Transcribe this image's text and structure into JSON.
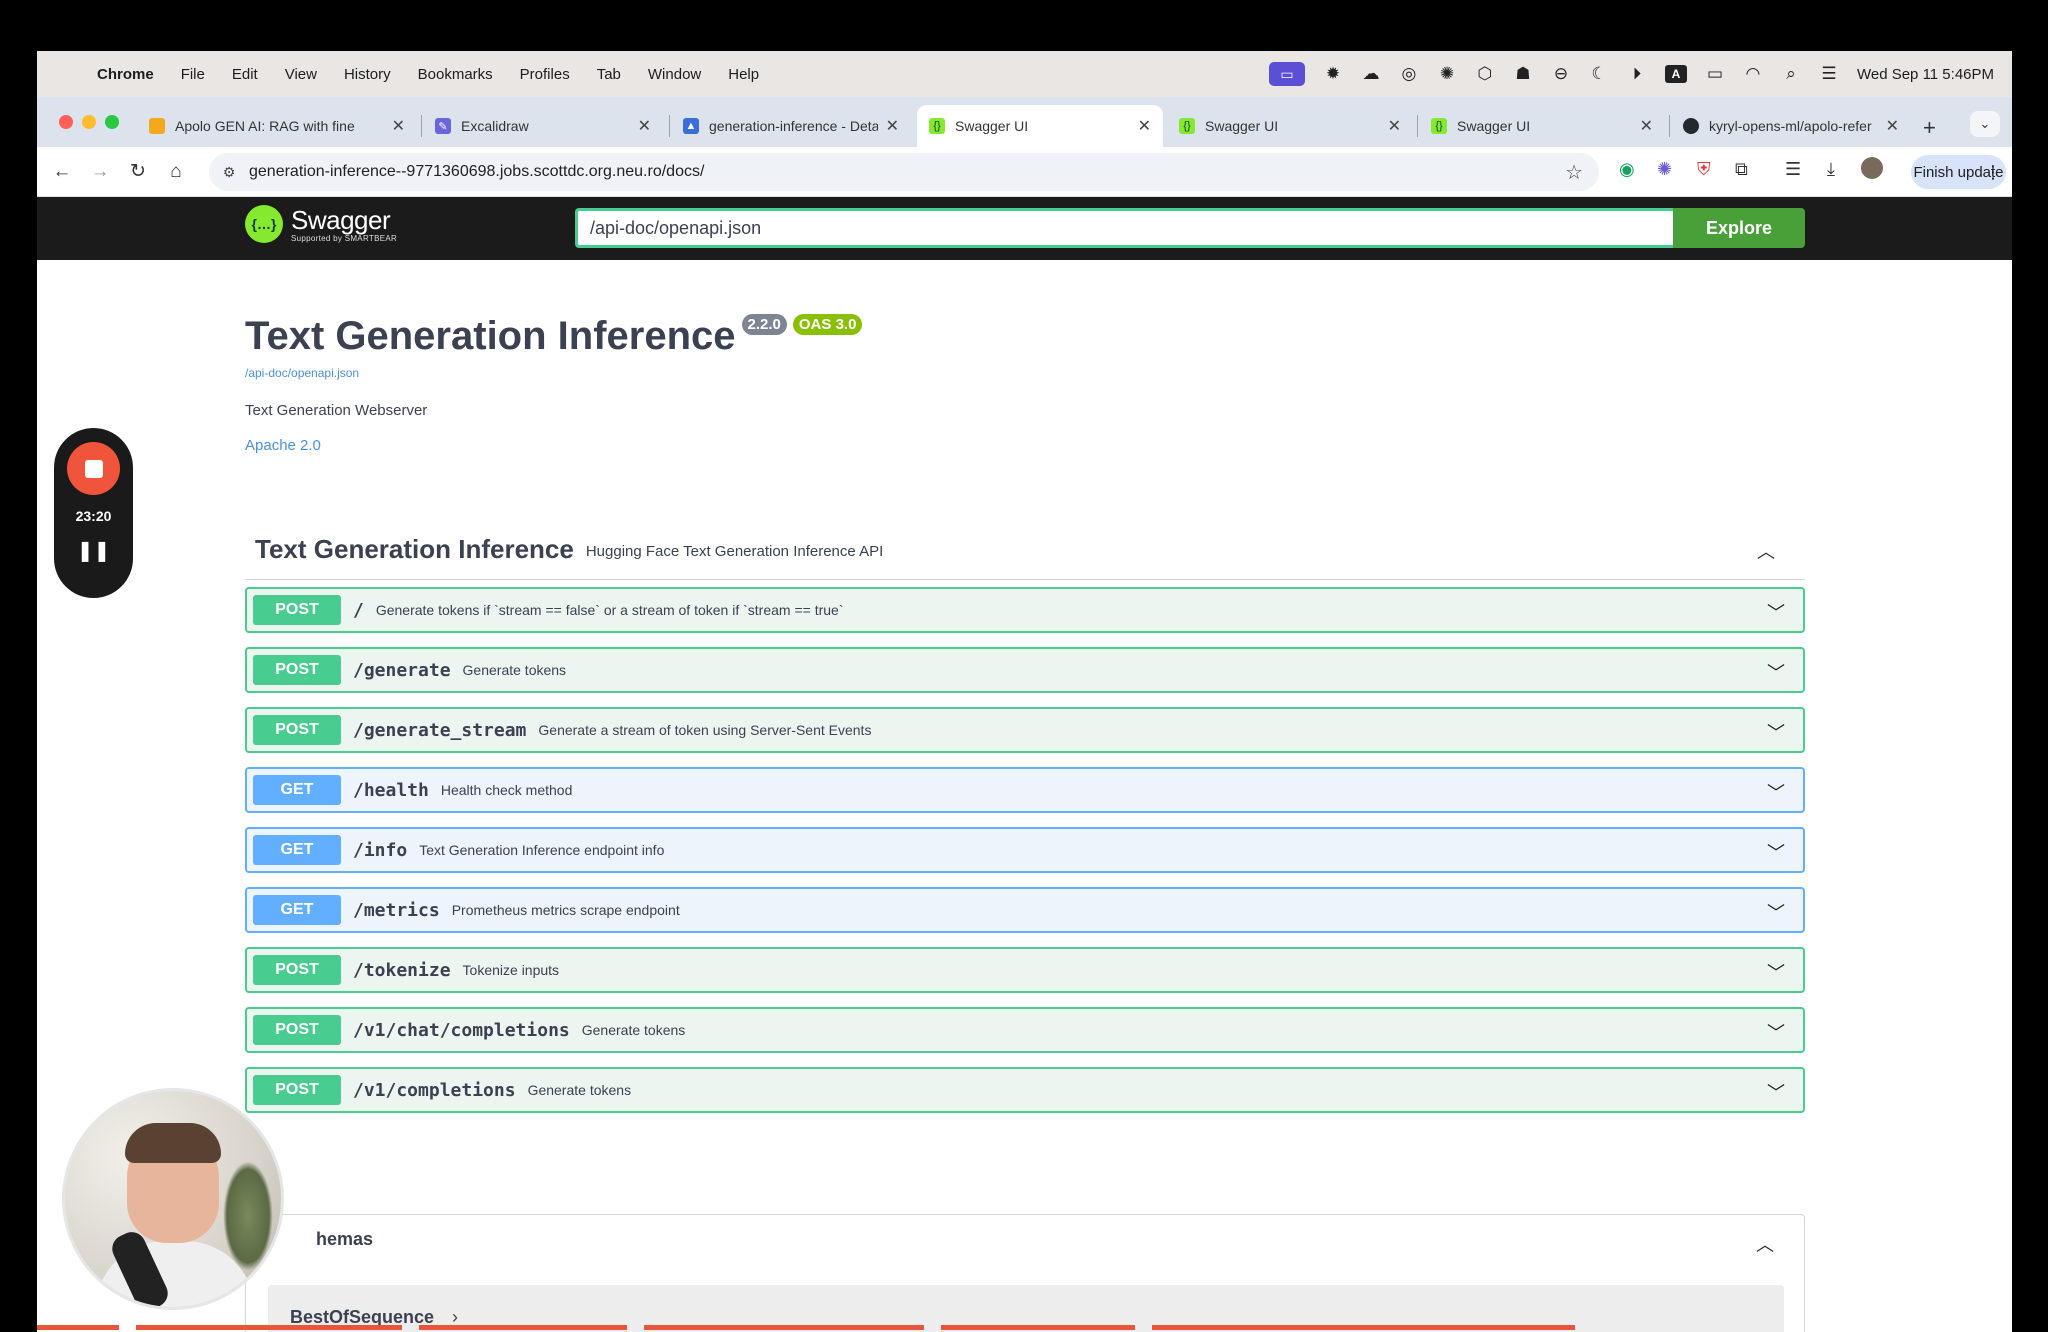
{
  "menubar": {
    "apple_icon": "apple-icon",
    "items": [
      "Chrome",
      "File",
      "Edit",
      "View",
      "History",
      "Bookmarks",
      "Profiles",
      "Tab",
      "Window",
      "Help"
    ],
    "clock": "Wed Sep 11  5:46PM"
  },
  "tabs": [
    {
      "label": "Apolo GEN AI: RAG with fine",
      "favicon_color": "#f3a81d",
      "active": false
    },
    {
      "label": "Excalidraw",
      "favicon_color": "#6965db",
      "active": false
    },
    {
      "label": "generation-inference - Deta",
      "favicon_color": "#3b6fd8",
      "active": false
    },
    {
      "label": "Swagger UI",
      "favicon_color": "#85ea2d",
      "active": true
    },
    {
      "label": "Swagger UI",
      "favicon_color": "#85ea2d",
      "active": false
    },
    {
      "label": "Swagger UI",
      "favicon_color": "#85ea2d",
      "active": false
    },
    {
      "label": "kyryl-opens-ml/apolo-refer",
      "favicon_color": "#24292f",
      "active": false
    }
  ],
  "toolbar": {
    "url": "generation-inference--9771360698.jobs.scottdc.org.neu.ro/docs/",
    "finish_update": "Finish update"
  },
  "swagger": {
    "logo_text": "Swagger",
    "logo_sub": "Supported by SMARTBEAR",
    "spec_input": "/api-doc/openapi.json",
    "explore_label": "Explore"
  },
  "info": {
    "title": "Text Generation Inference",
    "version": "2.2.0",
    "oas": "OAS 3.0",
    "spec_link": "/api-doc/openapi.json",
    "description": "Text Generation Webserver",
    "license": "Apache 2.0"
  },
  "tag": {
    "name": "Text Generation Inference",
    "description": "Hugging Face Text Generation Inference API"
  },
  "operations": [
    {
      "method": "POST",
      "path": "/",
      "summary": "Generate tokens if `stream == false` or a stream of token if `stream == true`"
    },
    {
      "method": "POST",
      "path": "/generate",
      "summary": "Generate tokens"
    },
    {
      "method": "POST",
      "path": "/generate_stream",
      "summary": "Generate a stream of token using Server-Sent Events"
    },
    {
      "method": "GET",
      "path": "/health",
      "summary": "Health check method"
    },
    {
      "method": "GET",
      "path": "/info",
      "summary": "Text Generation Inference endpoint info"
    },
    {
      "method": "GET",
      "path": "/metrics",
      "summary": "Prometheus metrics scrape endpoint"
    },
    {
      "method": "POST",
      "path": "/tokenize",
      "summary": "Tokenize inputs"
    },
    {
      "method": "POST",
      "path": "/v1/chat/completions",
      "summary": "Generate tokens"
    },
    {
      "method": "POST",
      "path": "/v1/completions",
      "summary": "Generate tokens"
    }
  ],
  "schemas": {
    "title": "hemas",
    "first_model": "BestOfSequence"
  },
  "recorder": {
    "time": "23:20"
  },
  "colors": {
    "post": "#49cc90",
    "get": "#61affe",
    "explore": "#49a038",
    "recorder_stop": "#f0553b"
  }
}
